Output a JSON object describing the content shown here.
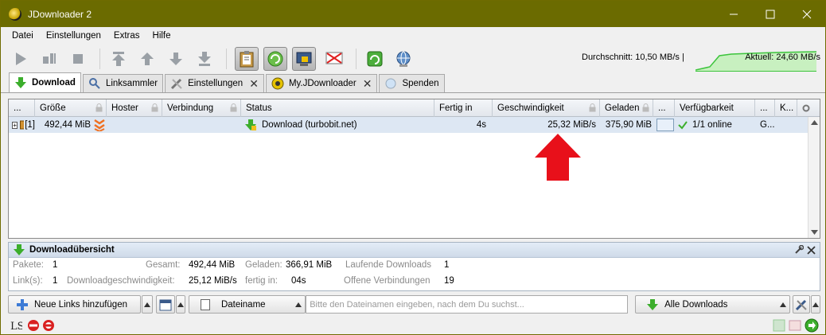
{
  "window": {
    "title": "JDownloader 2"
  },
  "menu": [
    "Datei",
    "Einstellungen",
    "Extras",
    "Hilfe"
  ],
  "speed": {
    "average": "Durchschnitt: 10,50 MB/s |",
    "current": "Aktuell: 24,60 MB/s"
  },
  "tabs": [
    {
      "label": "Download",
      "closable": false
    },
    {
      "label": "Linksammler",
      "closable": false
    },
    {
      "label": "Einstellungen",
      "closable": true
    },
    {
      "label": "My.JDownloader",
      "closable": true
    },
    {
      "label": "Spenden",
      "closable": false
    }
  ],
  "table": {
    "columns": [
      "...",
      "Größe",
      "Hoster",
      "Verbindung",
      "Status",
      "Fertig in",
      "Geschwindigkeit",
      "Geladen",
      "...",
      "Verfügbarkeit",
      "...",
      "K..."
    ],
    "row": {
      "expand": "+",
      "count": "[1]",
      "size": "492,44 MiB",
      "status": "Download (turbobit.net)",
      "eta": "4s",
      "speed": "25,32 MiB/s",
      "loaded": "375,90 MiB",
      "availability": "1/1 online",
      "extra": "G..."
    }
  },
  "overview": {
    "title": "Downloadübersicht",
    "packages_label": "Pakete:",
    "packages": "1",
    "total_label": "Gesamt:",
    "total": "492,44 MiB",
    "loaded_label": "Geladen:",
    "loaded": "366,91 MiB",
    "running_label": "Laufende Downloads",
    "running": "1",
    "links_label": "Link(s):",
    "links": "1",
    "dlspeed_label": "Downloadgeschwindigkeit:",
    "dlspeed": "25,12 MiB/s",
    "done_label": "fertig in:",
    "done": "04s",
    "connections_label": "Offene Verbindungen",
    "connections": "19"
  },
  "bottom": {
    "add_links": "Neue Links hinzufügen",
    "filename_select": "Dateiname",
    "search_placeholder": "Bitte den Dateinamen eingeben, nach dem Du suchst...",
    "filter_select": "Alle Downloads"
  },
  "colors": {
    "titlebar": "#6b6b00",
    "row_selected": "#dde7f3",
    "arrow": "#e8101a",
    "graph": "#3cc43c"
  }
}
